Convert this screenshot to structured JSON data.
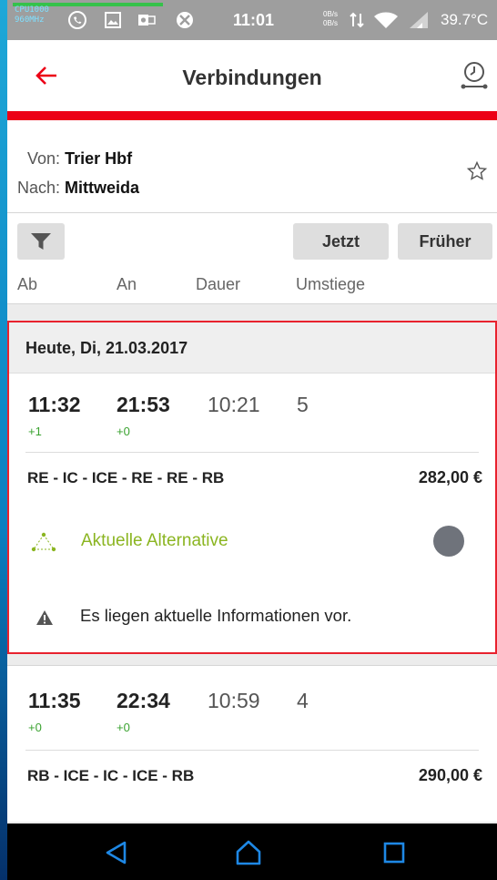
{
  "status_bar": {
    "cpu_lines": [
      "CPU1000",
      "960MHz"
    ],
    "time": "11:01",
    "net_up": "0B/s",
    "net_down": "0B/s",
    "temperature": "39.7°C"
  },
  "app_bar": {
    "title": "Verbindungen",
    "back_icon": "arrow-left-icon",
    "clock_icon": "clock-icon"
  },
  "route": {
    "from_label": "Von:",
    "from_value": "Trier Hbf",
    "to_label": "Nach:",
    "to_value": "Mittweida"
  },
  "toolbar": {
    "filter_icon": "filter-icon",
    "now_label": "Jetzt",
    "earlier_label": "Früher"
  },
  "columns": {
    "departure": "Ab",
    "arrival": "An",
    "duration": "Dauer",
    "transfers": "Umstiege"
  },
  "day_header": "Heute, Di, 21.03.2017",
  "connections": [
    {
      "departure": "11:32",
      "arrival": "21:53",
      "duration": "10:21",
      "transfers": "5",
      "departure_delay": "+1",
      "arrival_delay": "+0",
      "products": "RE - IC - ICE - RE - RE - RB",
      "price": "282,00 €",
      "alternative_label": "Aktuelle Alternative",
      "info_label": "Es liegen aktuelle Informationen vor."
    },
    {
      "departure": "11:35",
      "arrival": "22:34",
      "duration": "10:59",
      "transfers": "4",
      "departure_delay": "+0",
      "arrival_delay": "+0",
      "products": "RB - ICE - IC - ICE - RB",
      "price": "290,00 €"
    }
  ],
  "colors": {
    "db_red": "#ec0016",
    "delay_green": "#3aa230",
    "alternative_green": "#8bb521"
  }
}
